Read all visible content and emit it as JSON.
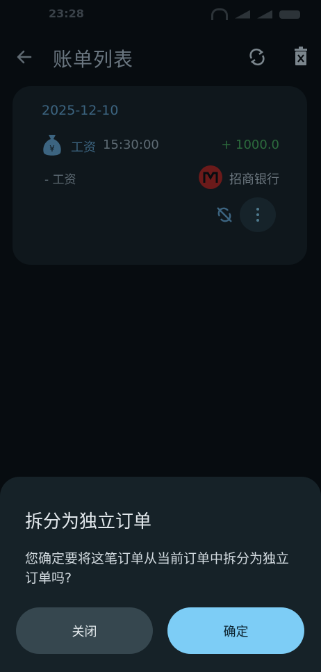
{
  "status_bar": {
    "time": "23:28"
  },
  "app_bar": {
    "title": "账单列表"
  },
  "card": {
    "date": "2025-12-10",
    "category": "工资",
    "time": "15:30:00",
    "amount": "+ 1000.0",
    "note": "- 工资",
    "bank": "招商银行",
    "icons": {
      "category": "money-bag-icon",
      "bank": "cmb-bank-logo",
      "unsync": "sync-disabled-icon",
      "more": "more-vert-icon"
    }
  },
  "dialog": {
    "title": "拆分为独立订单",
    "message": "您确定要将这笔订单从当前订单中拆分为独立订单吗?",
    "close_label": "关闭",
    "confirm_label": "确定"
  },
  "colors": {
    "background": "#070c10",
    "card": "#0f171c",
    "sheet": "#162228",
    "income": "#2c6b3d",
    "confirm": "#7dcdf6",
    "close": "#36474f"
  }
}
